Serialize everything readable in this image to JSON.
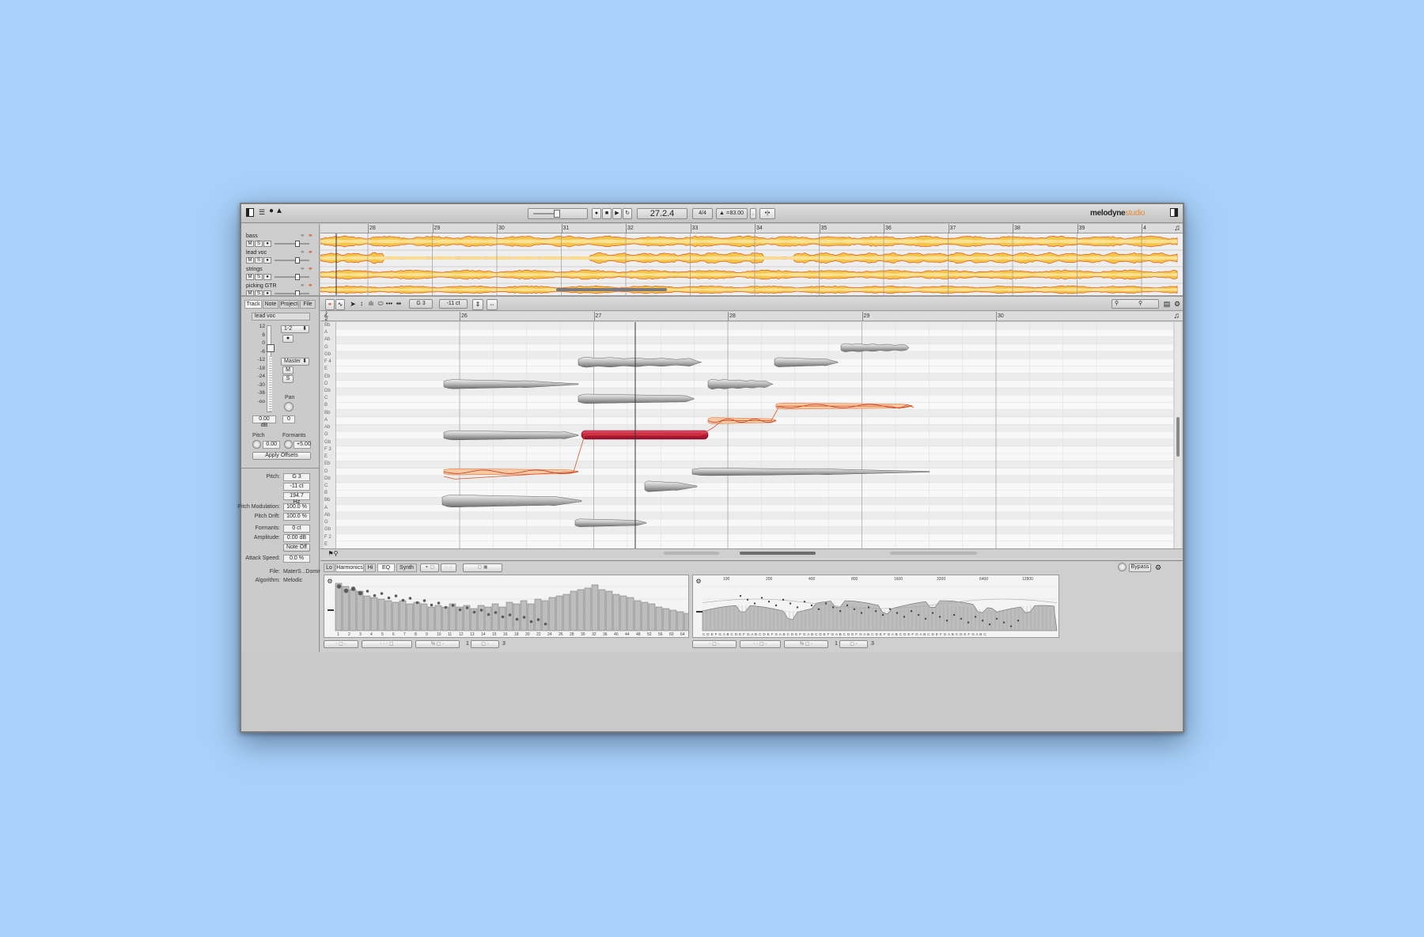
{
  "app": {
    "brand_a": "melodyne",
    "brand_b": "studio"
  },
  "transport": {
    "position": "27.2.4",
    "signature": "4/4",
    "tempo": "83.00",
    "tempo_prefix": "="
  },
  "tracks": [
    {
      "name": "bass",
      "mute": "M",
      "solo": "S"
    },
    {
      "name": "lead voc",
      "mute": "M",
      "solo": "S"
    },
    {
      "name": "strings",
      "mute": "M",
      "solo": "S"
    },
    {
      "name": "picking GTR",
      "mute": "M",
      "solo": "S"
    }
  ],
  "overview_bars": [
    "28",
    "29",
    "30",
    "31",
    "32",
    "33",
    "34",
    "35",
    "36",
    "37",
    "38",
    "39",
    "4"
  ],
  "editor_bars": [
    "26",
    "27",
    "28",
    "29",
    "30"
  ],
  "editor_toolbar": {
    "note": "G 3",
    "cents": "-11 ct"
  },
  "note_names": [
    "Bb",
    "A",
    "Ab",
    "G",
    "Gb",
    "F 4",
    "E",
    "Eb",
    "D",
    "Db",
    "C",
    "B",
    "Bb",
    "A",
    "Ab",
    "G",
    "Gb",
    "F 3",
    "E",
    "Eb",
    "D",
    "Db",
    "C",
    "B",
    "Bb",
    "A",
    "Ab",
    "G",
    "Gb",
    "F 2",
    "E"
  ],
  "inspector": {
    "tabs": [
      "Track",
      "Note",
      "Project",
      "File"
    ],
    "track_name": "lead voc",
    "scale": [
      "12",
      "6",
      "0",
      "-6",
      "-12",
      "-18",
      "-24",
      "-30",
      "-36",
      "-oo"
    ],
    "routing": "1-2",
    "output": "Master",
    "m": "M",
    "s": "S",
    "pan_label": "Pan",
    "db": "0.00 dB",
    "pan_val": "0",
    "pitch_label": "Pitch",
    "formants_label": "Formants",
    "pitch_val": "0.00",
    "formants_val": "+5.00",
    "apply": "Apply Offsets"
  },
  "note_props": {
    "pitch_label": "Pitch:",
    "pitch": "G 3",
    "cents": "-11 ct",
    "hz": "194.7 Hz",
    "mod_label": "Pitch Modulation:",
    "mod": "100.0 %",
    "drift_label": "Pitch Drift:",
    "drift": "100.0 %",
    "form_label": "Formants:",
    "form": "0 ct",
    "amp_label": "Amplitude:",
    "amp": "0.00 dB",
    "noteoff": "Note Off",
    "attack_label": "Attack Speed:",
    "attack": "0.0 %",
    "file_label": "File:",
    "file": "MaterS...Domini",
    "algo_label": "Algorithm:",
    "algo": "Melodic"
  },
  "sound_editor": {
    "tabs": [
      "Lo",
      "Harmonics",
      "Hi",
      "EQ",
      "Synth"
    ],
    "bypass": "Bypass",
    "harm_numbers": [
      "1",
      "2",
      "3",
      "4",
      "5",
      "6",
      "7",
      "8",
      "9",
      "10",
      "11",
      "12",
      "13",
      "14",
      "15",
      "16",
      "18",
      "20",
      "22",
      "24",
      "26",
      "28",
      "30",
      "32",
      "36",
      "40",
      "44",
      "48",
      "52",
      "56",
      "60",
      "64"
    ],
    "freq_labels": [
      "100",
      "200",
      "400",
      "800",
      "1600",
      "3200",
      "6400",
      "12800"
    ],
    "eq_notes": "C D E F G A B C D E F G A B C D E F G A B C D E F G A B C D E F G A B C D E F G A B C D E F G A B C D E F G A B C D E F G A B C D E F G A B C",
    "foot_left_num": "1",
    "foot_left_num2": "3",
    "foot_right_num": "1",
    "foot_right_num2": "3"
  }
}
